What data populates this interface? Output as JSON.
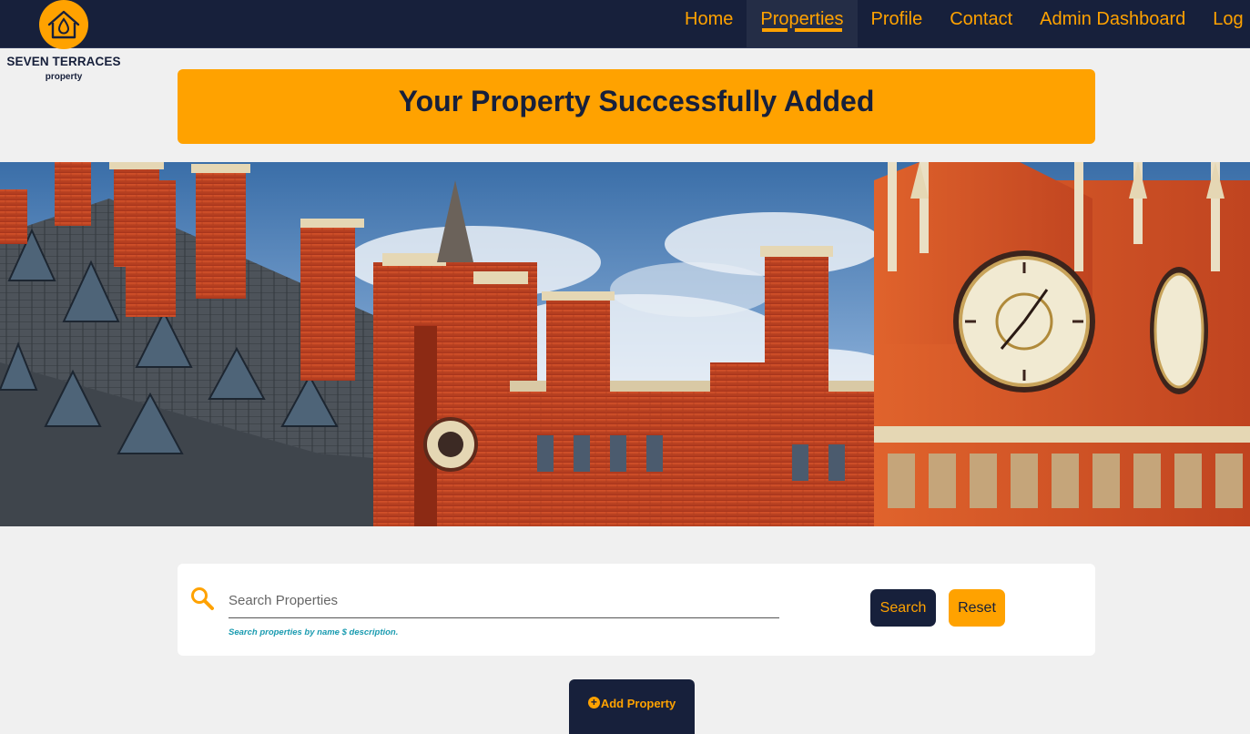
{
  "brand": {
    "name": "SEVEN TERRACES",
    "tagline": "property",
    "logo_icon": "house-drop-icon",
    "color_primary": "#ffa200",
    "color_dark": "#17203b"
  },
  "nav": {
    "items": [
      {
        "label": "Home",
        "active": false
      },
      {
        "label": "Properties",
        "active": true
      },
      {
        "label": "Profile",
        "active": false
      },
      {
        "label": "Contact",
        "active": false
      },
      {
        "label": "Admin Dashboard",
        "active": false
      },
      {
        "label": "Log",
        "active": false
      }
    ]
  },
  "banner": {
    "message": "Your Property Successfully Added"
  },
  "hero": {
    "image": "gothic-red-brick-building-with-clock-tower"
  },
  "search": {
    "icon": "search-icon",
    "placeholder": "Search Properties",
    "value": "",
    "hint": "Search properties by name $ description.",
    "search_label": "Search",
    "reset_label": "Reset"
  },
  "actions": {
    "add_icon": "plus-circle-icon",
    "add_label": "Add Property"
  }
}
